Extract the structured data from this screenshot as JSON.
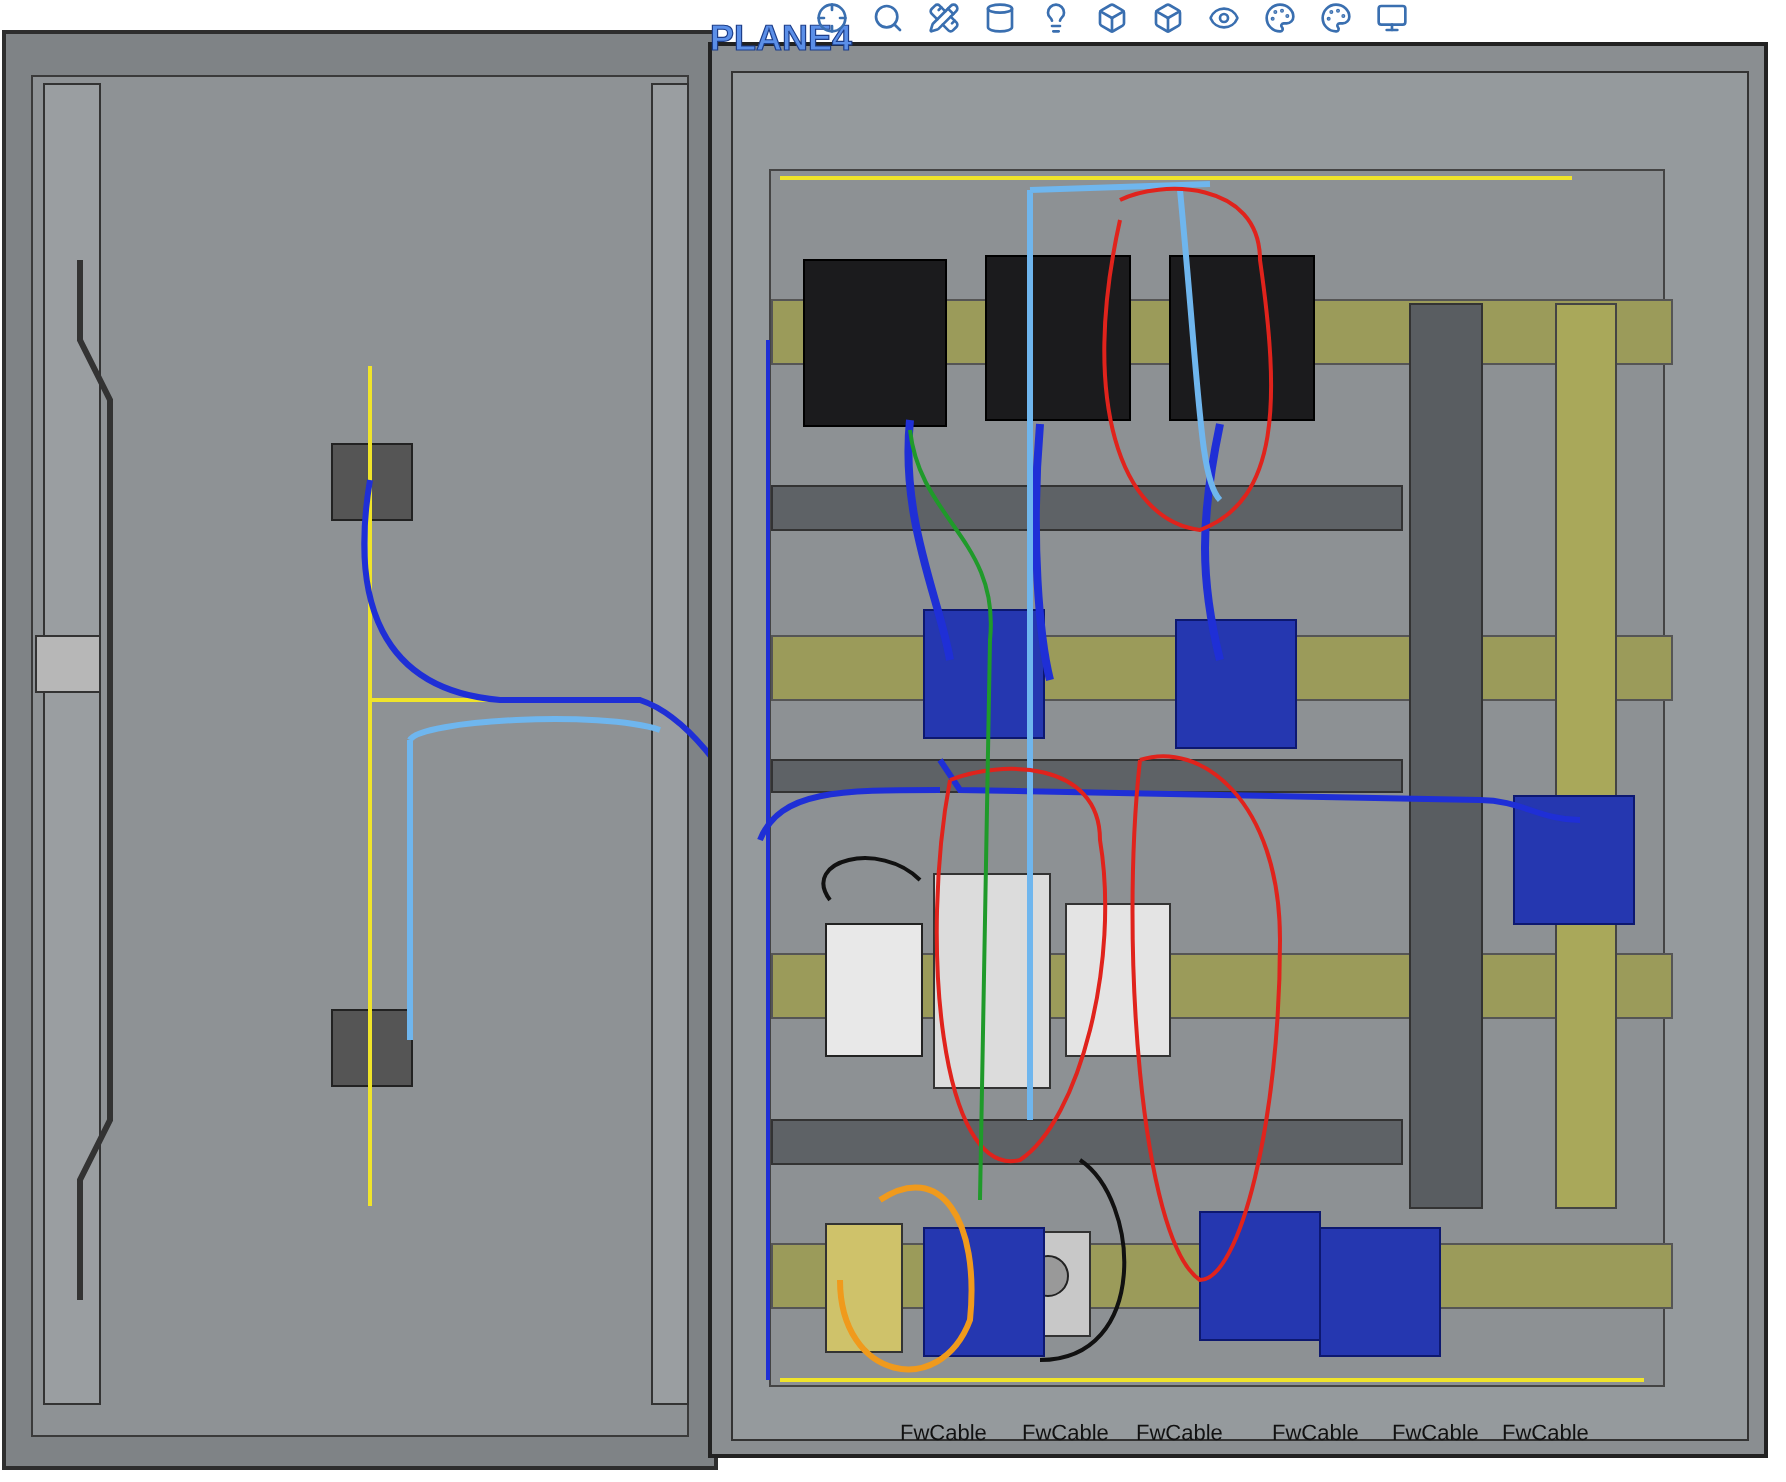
{
  "viewport": {
    "plane_label": "PLANE4"
  },
  "cable_labels": [
    "FwCable",
    "FwCable",
    "FwCable",
    "FwCable",
    "FwCable",
    "FwCable"
  ]
}
